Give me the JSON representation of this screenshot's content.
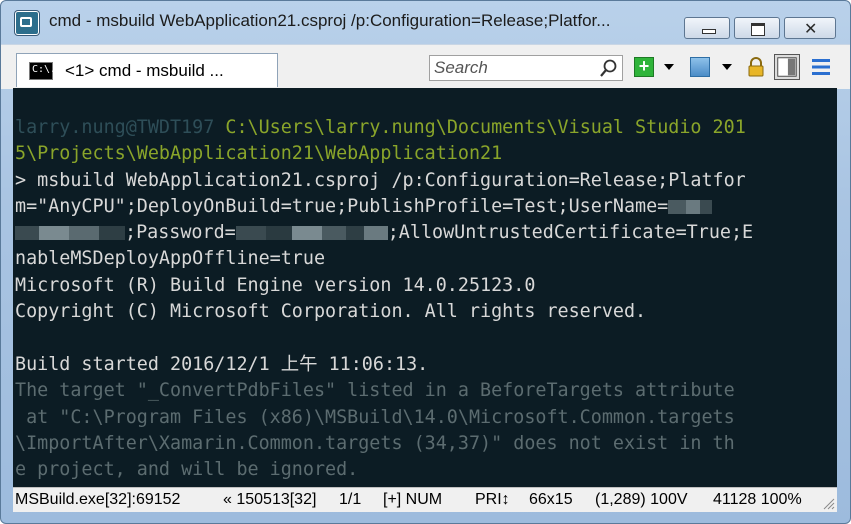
{
  "window": {
    "title": "cmd - msbuild  WebApplication21.csproj /p:Configuration=Release;Platfor..."
  },
  "tab": {
    "icon_text": "C:\\.",
    "label": "<1> cmd - msbuild  ..."
  },
  "search": {
    "placeholder": "Search"
  },
  "console": {
    "prompt_user": "larry.nung@TWDT197",
    "prompt_path_1": " C:\\Users\\larry.nung\\Documents\\Visual Studio 201",
    "prompt_path_2": "5\\Projects\\WebApplication21\\WebApplication21",
    "cmd_1": "> msbuild WebApplication21.csproj /p:Configuration=Release;Platfor",
    "cmd_2a": "m=\"AnyCPU\";DeployOnBuild=true;PublishProfile=Test;UserName=",
    "cmd_3a": ";Password=",
    "cmd_3b": ";AllowUntrustedCertificate=True;E",
    "cmd_4": "nableMSDeployAppOffline=true",
    "out_1": "Microsoft (R) Build Engine version 14.0.25123.0",
    "out_2": "Copyright (C) Microsoft Corporation. All rights reserved.",
    "out_3": "Build started 2016/12/1 上午 11:06:13.",
    "warn_1": "The target \"_ConvertPdbFiles\" listed in a BeforeTargets attribute",
    "warn_2": " at \"C:\\Program Files (x86)\\MSBuild\\14.0\\Microsoft.Common.targets",
    "warn_3": "\\ImportAfter\\Xamarin.Common.targets (34,37)\" does not exist in th",
    "warn_4": "e project, and will be ignored."
  },
  "status": {
    "process": "MSBuild.exe[32]:69152",
    "pid": "« 150513[32]",
    "pages": "1/1",
    "ins": "[+] NUM",
    "pri": "PRI↕",
    "size": "66x15",
    "cursor": "(1,289) 100V",
    "mem": "41128 100%"
  },
  "colors": {
    "console_bg": "#0c1c24",
    "prompt_dim": "#2e4e58",
    "path_green": "#8aa52a",
    "text": "#d8d8d8",
    "warning_gray": "#5c6c70"
  },
  "icons": [
    "app-icon",
    "close-icon",
    "search-icon",
    "plus-icon",
    "terminal-icon",
    "lock-icon",
    "panel-icon",
    "menu-icon"
  ]
}
